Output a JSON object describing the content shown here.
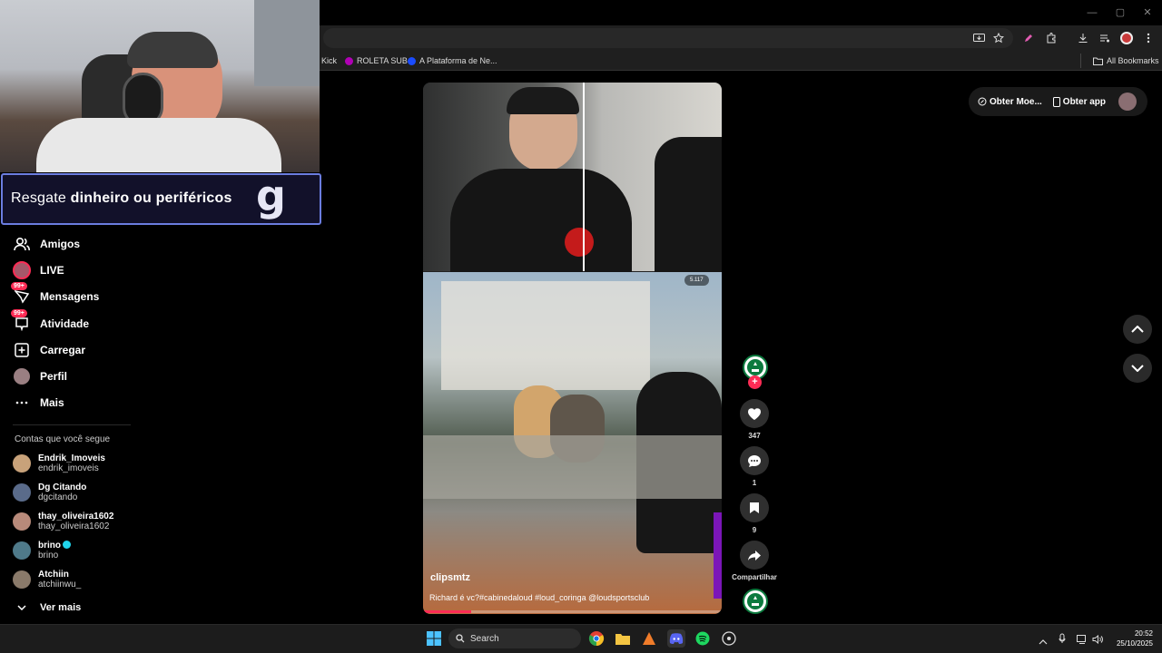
{
  "browser": {
    "window_controls": [
      "—",
      "▢",
      "✕"
    ],
    "bookmarks": [
      {
        "label": "Kick",
        "color": "#53fc18"
      },
      {
        "label": "ROLETA SUB",
        "color": "#b000b5"
      },
      {
        "label": "A Plataforma de Ne...",
        "color": "#1a4cff"
      }
    ],
    "all_bookmarks_label": "All Bookmarks"
  },
  "overlay": {
    "banner_prefix": "Resgate ",
    "banner_bold": "dinheiro ou periféricos",
    "banner_logo": "g"
  },
  "sidebar": {
    "items": [
      {
        "label": "Amigos",
        "icon": "friends-icon"
      },
      {
        "label": "LIVE",
        "icon": "live-avatar-icon"
      },
      {
        "label": "Mensagens",
        "icon": "messages-icon",
        "badge": "99+"
      },
      {
        "label": "Atividade",
        "icon": "activity-icon",
        "badge": "99+"
      },
      {
        "label": "Carregar",
        "icon": "upload-icon"
      },
      {
        "label": "Perfil",
        "icon": "profile-avatar-icon"
      },
      {
        "label": "Mais",
        "icon": "more-icon"
      }
    ],
    "following_title": "Contas que você segue",
    "following": [
      {
        "name": "Endrik_Imoveis",
        "handle": "endrik_imoveis",
        "color": "#c8a27a",
        "verified": false
      },
      {
        "name": "Dg Citando",
        "handle": "dgcitando",
        "color": "#5a6b8a",
        "verified": false
      },
      {
        "name": "thay_oliveira1602",
        "handle": "thay_oliveira1602",
        "color": "#b88a7a",
        "verified": false
      },
      {
        "name": "brino",
        "handle": "brino",
        "color": "#4f7a8a",
        "verified": true
      },
      {
        "name": "Atchiin",
        "handle": "atchiinwu_",
        "color": "#8a7a6a",
        "verified": false
      }
    ],
    "see_more": "Ver mais"
  },
  "video": {
    "username": "clipsmtz",
    "caption": "Richard é vc?#cabinedaloud #loud_coringa @loudsportsclub",
    "views": "5.117",
    "progress": 0.16
  },
  "actions": {
    "likes": "347",
    "comments": "1",
    "saves": "9",
    "share_label": "Compartilhar"
  },
  "topbar": {
    "coins_label": "Obter Moe...",
    "app_label": "Obter app"
  },
  "taskbar": {
    "search_label": "Search",
    "time": "20:52",
    "date": "25/10/2025"
  },
  "colors": {
    "accent": "#fe2c55",
    "verified": "#20d5ec",
    "banner_border": "#6b7de0"
  }
}
